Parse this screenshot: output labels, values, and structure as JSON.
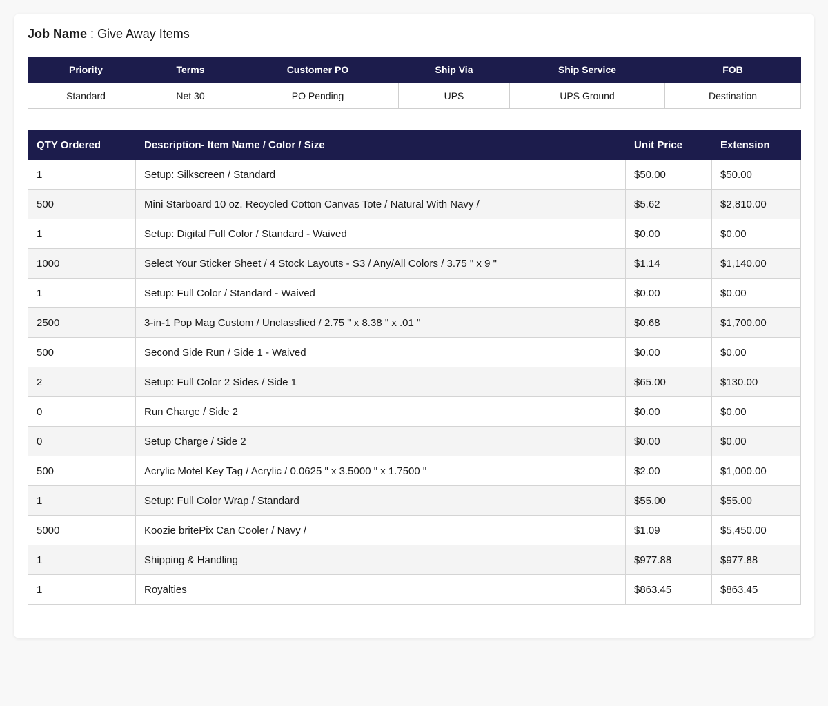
{
  "job": {
    "label": "Job Name",
    "separator": " : ",
    "value": "Give Away Items"
  },
  "summary": {
    "headers": [
      "Priority",
      "Terms",
      "Customer PO",
      "Ship Via",
      "Ship Service",
      "FOB"
    ],
    "values": [
      "Standard",
      "Net 30",
      "PO Pending",
      "UPS",
      "UPS Ground",
      "Destination"
    ]
  },
  "items": {
    "headers": [
      "QTY Ordered",
      "Description- Item Name / Color / Size",
      "Unit Price",
      "Extension"
    ],
    "rows": [
      {
        "qty": "1",
        "desc": "Setup: Silkscreen / Standard",
        "unit": "$50.00",
        "ext": "$50.00"
      },
      {
        "qty": "500",
        "desc": "Mini Starboard 10 oz. Recycled Cotton Canvas Tote / Natural With Navy /",
        "unit": "$5.62",
        "ext": "$2,810.00"
      },
      {
        "qty": "1",
        "desc": "Setup: Digital Full Color / Standard - Waived",
        "unit": "$0.00",
        "ext": "$0.00"
      },
      {
        "qty": "1000",
        "desc": "Select Your Sticker Sheet / 4 Stock Layouts - S3 / Any/All Colors / 3.75 \" x 9 \"",
        "unit": "$1.14",
        "ext": "$1,140.00"
      },
      {
        "qty": "1",
        "desc": "Setup: Full Color / Standard - Waived",
        "unit": "$0.00",
        "ext": "$0.00"
      },
      {
        "qty": "2500",
        "desc": "3-in-1 Pop Mag Custom / Unclassfied / 2.75 \" x 8.38 \" x .01 \"",
        "unit": "$0.68",
        "ext": "$1,700.00"
      },
      {
        "qty": "500",
        "desc": "Second Side Run / Side 1 - Waived",
        "unit": "$0.00",
        "ext": "$0.00"
      },
      {
        "qty": "2",
        "desc": "Setup: Full Color 2 Sides / Side 1",
        "unit": "$65.00",
        "ext": "$130.00"
      },
      {
        "qty": "0",
        "desc": "Run Charge / Side 2",
        "unit": "$0.00",
        "ext": "$0.00"
      },
      {
        "qty": "0",
        "desc": "Setup Charge / Side 2",
        "unit": "$0.00",
        "ext": "$0.00"
      },
      {
        "qty": "500",
        "desc": "Acrylic Motel Key Tag / Acrylic / 0.0625 \" x 3.5000 \" x 1.7500 \"",
        "unit": "$2.00",
        "ext": "$1,000.00"
      },
      {
        "qty": "1",
        "desc": "Setup: Full Color Wrap / Standard",
        "unit": "$55.00",
        "ext": "$55.00"
      },
      {
        "qty": "5000",
        "desc": "Koozie britePix Can Cooler / Navy /",
        "unit": "$1.09",
        "ext": "$5,450.00"
      },
      {
        "qty": "1",
        "desc": "Shipping & Handling",
        "unit": "$977.88",
        "ext": "$977.88"
      },
      {
        "qty": "1",
        "desc": "Royalties",
        "unit": "$863.45",
        "ext": "$863.45"
      }
    ]
  },
  "colors": {
    "header_bg": "#1c1c4c",
    "header_text": "#ffffff",
    "stripe": "#f4f4f4"
  }
}
